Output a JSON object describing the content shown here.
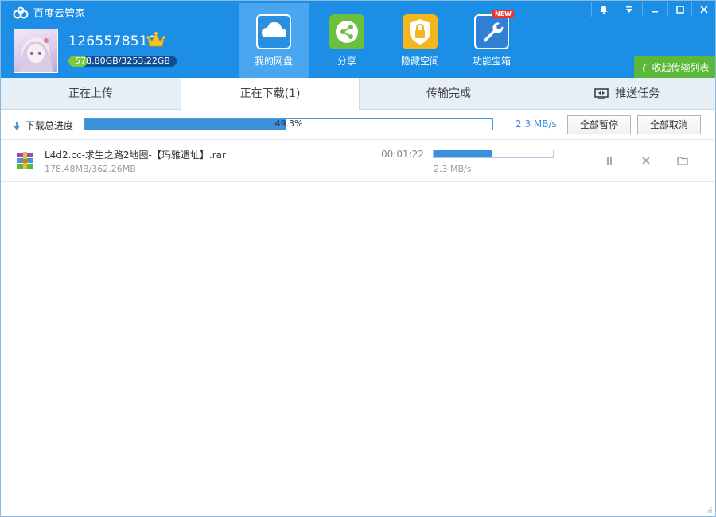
{
  "app": {
    "title": "百度云管家"
  },
  "user": {
    "name": "1265578519",
    "quota_text": "578.80GB/3253.22GB",
    "quota_used_fraction": 0.178
  },
  "nav": [
    {
      "label": "我的网盘",
      "icon": "cloud-icon",
      "active": true
    },
    {
      "label": "分享",
      "icon": "share-icon",
      "active": false
    },
    {
      "label": "隐藏空间",
      "icon": "lock-icon",
      "active": false
    },
    {
      "label": "功能宝箱",
      "icon": "toolbox-icon",
      "badge": "NEW",
      "active": false
    }
  ],
  "collapse_label": "收起传输列表",
  "tabs": [
    {
      "label": "正在上传"
    },
    {
      "label": "正在下载(1)",
      "active": true
    },
    {
      "label": "传输完成"
    },
    {
      "label": "推送任务",
      "icon": "push-monitor-icon"
    }
  ],
  "total": {
    "label": "下载总进度",
    "percent_text": "49.3%",
    "percent": 49.3,
    "speed": "2.3 MB/s",
    "pause_all": "全部暂停",
    "cancel_all": "全部取消"
  },
  "tasks": [
    {
      "name": "L4d2.cc-求生之路2地图-【玛雅遗址】.rar",
      "size": "178.48MB/362.26MB",
      "time_left": "00:01:22",
      "speed": "2.3 MB/s",
      "progress": 0.493
    }
  ],
  "colors": {
    "header": "#1c8ee6",
    "accent": "#3c8fda",
    "collapse": "#5cb83a"
  }
}
